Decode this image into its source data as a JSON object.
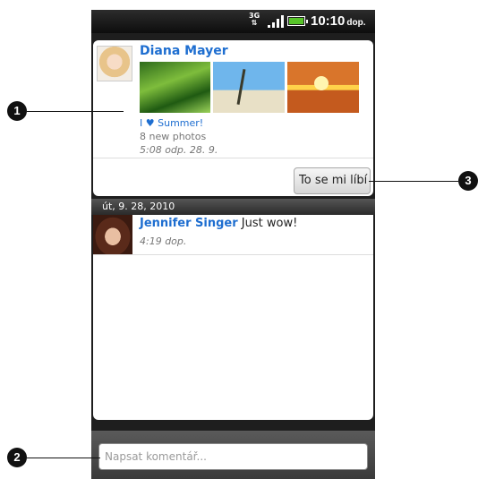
{
  "status_bar": {
    "network": "3G",
    "time": "10:10",
    "ampm": "dop."
  },
  "post": {
    "author": "Diana Mayer",
    "album_prefix": "I",
    "album_suffix": "Summer!",
    "photo_count": "8 new photos",
    "timestamp": "5:08 odp. 28. 9.",
    "like_label": "To se mi líbí"
  },
  "date_header": "út, 9. 28, 2010",
  "comment": {
    "author": "Jennifer Singer",
    "text": "Just wow!",
    "timestamp": "4:19 dop."
  },
  "input": {
    "placeholder": "Napsat komentář..."
  },
  "callouts": {
    "c1": "1",
    "c2": "2",
    "c3": "3"
  },
  "icons": {
    "album_heart": "heart-icon"
  },
  "colors": {
    "link": "#1e6ed0",
    "battery": "#57c429"
  }
}
